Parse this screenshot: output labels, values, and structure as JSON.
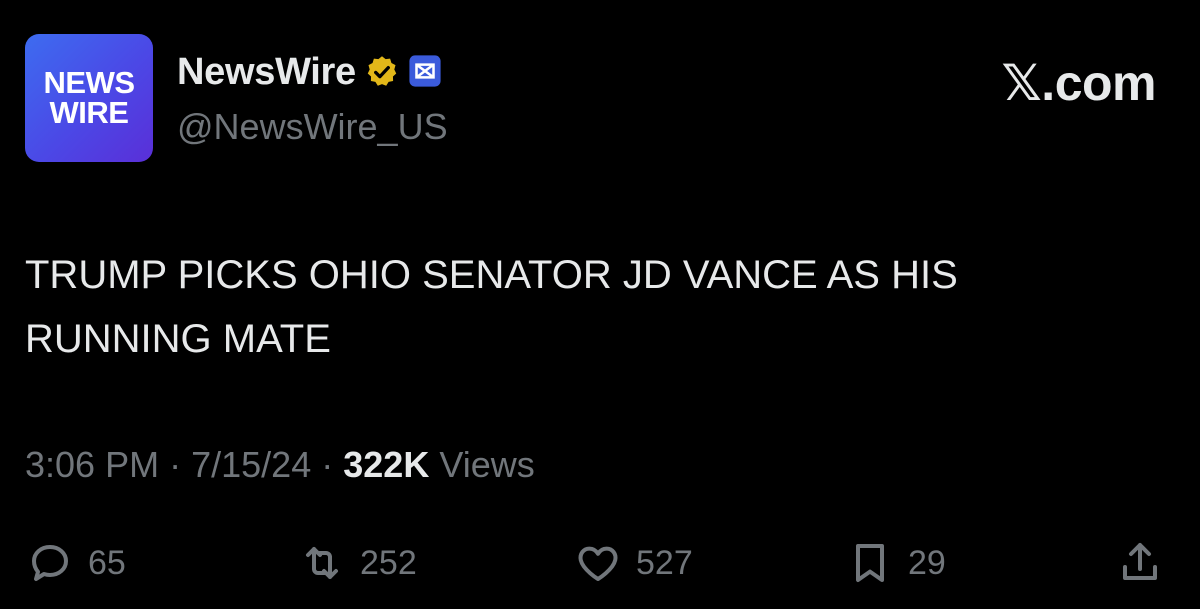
{
  "account": {
    "avatar_line1": "NEWS",
    "avatar_line2": "WIRE",
    "display_name": "NewsWire",
    "handle": "@NewsWire_US"
  },
  "source_label": "𝕏.com",
  "tweet": {
    "text": "TRUMP PICKS OHIO SENATOR JD VANCE AS HIS RUNNING MATE",
    "time": "3:06 PM",
    "separator": "·",
    "date": "7/15/24",
    "views_count": "322K",
    "views_label": "Views"
  },
  "actions": {
    "replies": "65",
    "reposts": "252",
    "likes": "527",
    "bookmarks": "29"
  },
  "colors": {
    "background": "#000000",
    "text": "#e7e9ea",
    "muted": "#71767b",
    "verified_badge": "#e2b719",
    "affiliate_badge": "#3b5bdb"
  },
  "icons": [
    "verified-badge-icon",
    "affiliate-badge-icon",
    "reply-icon",
    "repost-icon",
    "like-icon",
    "bookmark-icon",
    "share-icon"
  ]
}
